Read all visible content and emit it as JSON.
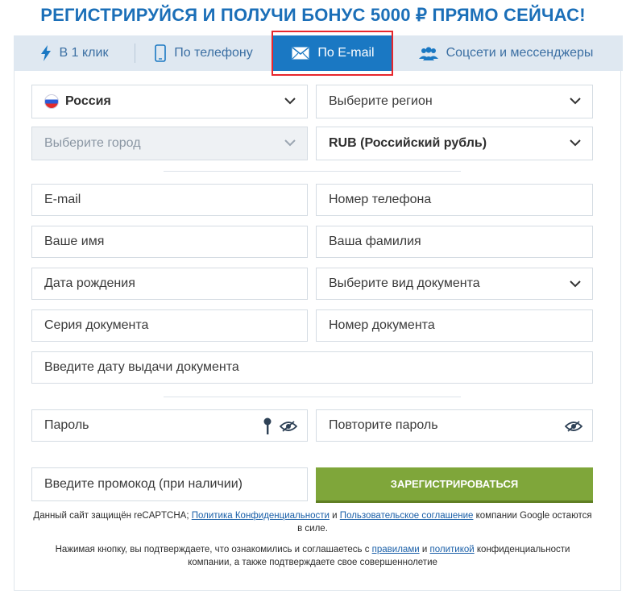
{
  "header": {
    "title": "РЕГИСТРИРУЙСЯ И ПОЛУЧИ БОНУС 5000 ₽ ПРЯМО СЕЙЧАС!"
  },
  "tabs": [
    {
      "label": "В 1 клик",
      "icon": "lightning-icon"
    },
    {
      "label": "По телефону",
      "icon": "phone-icon"
    },
    {
      "label": "По E-mail",
      "icon": "envelope-icon",
      "active": true
    },
    {
      "label": "Соцсети и мессенджеры",
      "icon": "people-icon"
    }
  ],
  "form": {
    "country": "Россия",
    "region_placeholder": "Выберите регион",
    "city_placeholder": "Выберите город",
    "currency": "RUB (Российский рубль)",
    "email_placeholder": "E-mail",
    "phone_placeholder": "Номер телефона",
    "name_placeholder": "Ваше имя",
    "surname_placeholder": "Ваша фамилия",
    "birthdate_placeholder": "Дата рождения",
    "doc_type_placeholder": "Выберите вид документа",
    "doc_series_placeholder": "Серия документа",
    "doc_number_placeholder": "Номер документа",
    "doc_issue_date_placeholder": "Введите дату выдачи документа",
    "password_placeholder": "Пароль",
    "repeat_password_placeholder": "Повторите пароль",
    "promo_placeholder": "Введите промокод (при наличии)",
    "submit_label": "ЗАРЕГИСТРИРОВАТЬСЯ"
  },
  "legal": {
    "recaptcha_prefix": "Данный сайт защищён reCAPTCHA;",
    "privacy_link": "Политика Конфиденциальности",
    "and": "и",
    "terms_link": "Пользовательское соглашение",
    "recaptcha_suffix": "компании Google остаются в силе.",
    "consent_prefix": "Нажимая кнопку, вы подтверждаете, что ознакомились и соглашаетесь с",
    "rules_link": "правилами",
    "and2": "и",
    "policy_link": "политикой",
    "consent_suffix": "конфиденциальности компании, а также подтверждаете свое совершеннолетие"
  },
  "colors": {
    "accent": "#1a78c3",
    "title": "#1b6fb8",
    "button": "#7fa63a",
    "highlight": "#e8262c"
  }
}
